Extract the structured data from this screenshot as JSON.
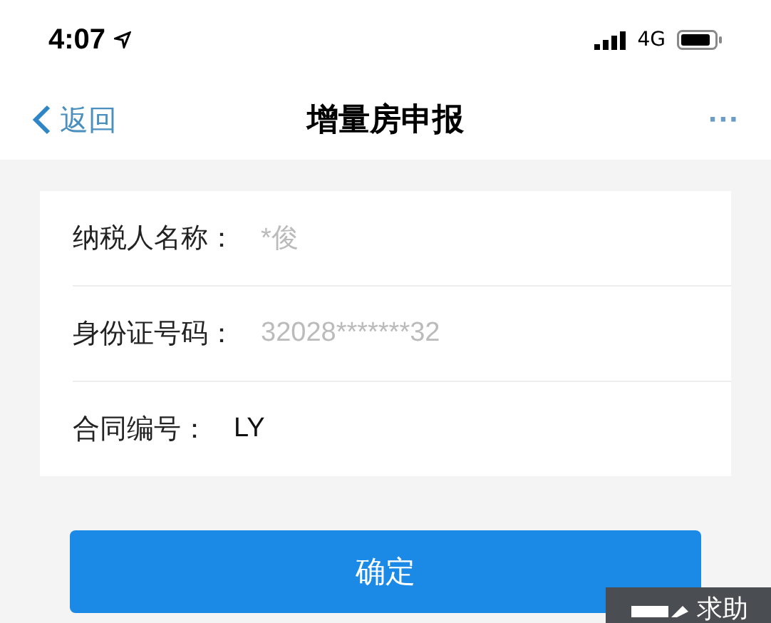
{
  "status_bar": {
    "time": "4:07",
    "network": "4G"
  },
  "nav": {
    "back": "返回",
    "title": "增量房申报",
    "more": "···"
  },
  "fields": [
    {
      "label": "纳税人名称：",
      "value": "*俊",
      "readonly": true
    },
    {
      "label": "身份证号码：",
      "value": "32028*******32",
      "readonly": true
    },
    {
      "label": "合同编号：",
      "value": "LY",
      "readonly": false
    }
  ],
  "confirm": "确定",
  "help": "求助"
}
